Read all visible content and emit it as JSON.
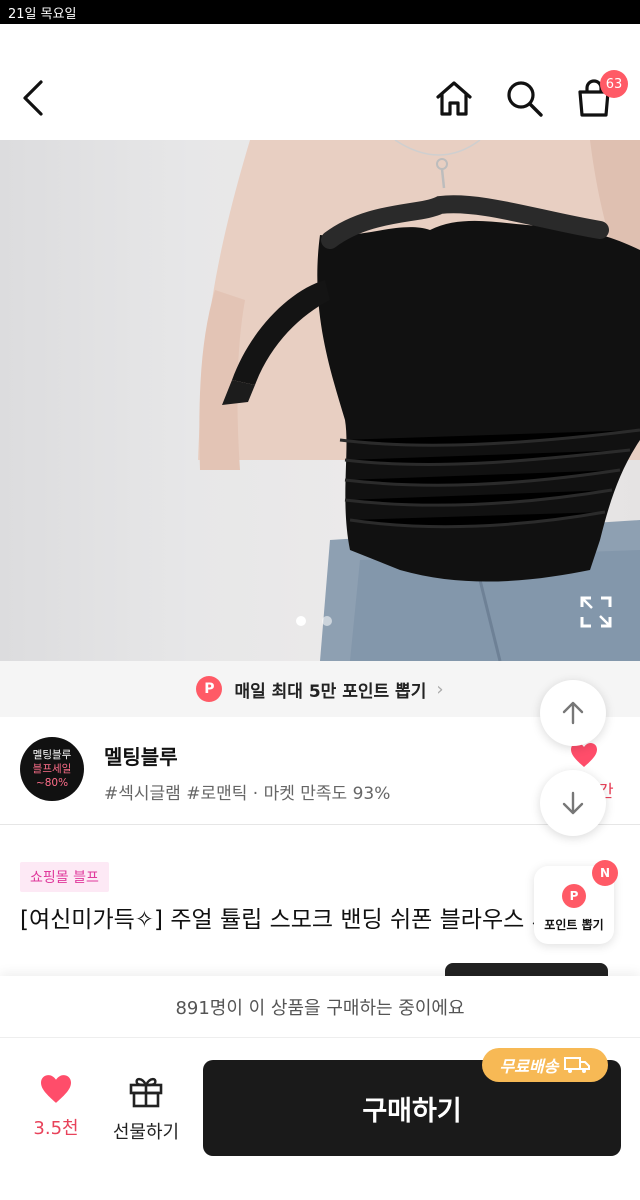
{
  "status_bar": {
    "time": "21일 목요일"
  },
  "header": {
    "cart_count": "63"
  },
  "hero": {
    "image_count": 2,
    "active_index": 0
  },
  "banner": {
    "icon": "P",
    "text": "매일 최대 5만 포인트 뽑기"
  },
  "store": {
    "logo_line1": "멜팅블루",
    "logo_line2": "블프세일",
    "logo_line3": "~80%",
    "name": "멜팅블루",
    "tags": "#섹시글램 #로맨틱 · 마켓 만족도 93%",
    "partial_text": "간"
  },
  "product": {
    "tag": "쇼핑몰 블프",
    "title": "[여신미가득✧] 주얼 튤립 스모크 밴딩 쉬폰 블라우스 시"
  },
  "floating": {
    "point_icon": "P",
    "point_label": "포인트 뽑기",
    "new_badge": "N"
  },
  "bottom": {
    "buying_text": "891명이 이 상품을 구매하는 중이에요",
    "like_count": "3.5천",
    "gift_label": "선물하기",
    "buy_label": "구매하기",
    "free_shipping": "무료배송"
  },
  "colors": {
    "accent": "#ff5a66",
    "buy_button": "#1a1a1a",
    "shipping_badge": "#f7b955"
  }
}
